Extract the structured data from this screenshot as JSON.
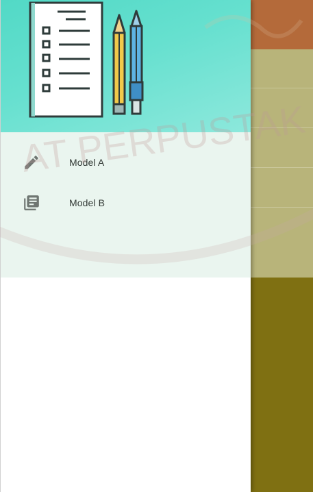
{
  "drawer": {
    "items": [
      {
        "label": "Model A",
        "icon": "pencil-icon"
      },
      {
        "label": "Model B",
        "icon": "library-books-icon"
      }
    ]
  },
  "watermark": {
    "text": "AT PERPUSTAK"
  },
  "colors": {
    "header_gradient_start": "#52d9c6",
    "header_gradient_end": "#8de8dc",
    "menu_background": "#eaf5ef",
    "dimmed_toolbar": "#b46a3a",
    "dimmed_list": "#b8b47a",
    "dimmed_lower": "#7f7012"
  }
}
